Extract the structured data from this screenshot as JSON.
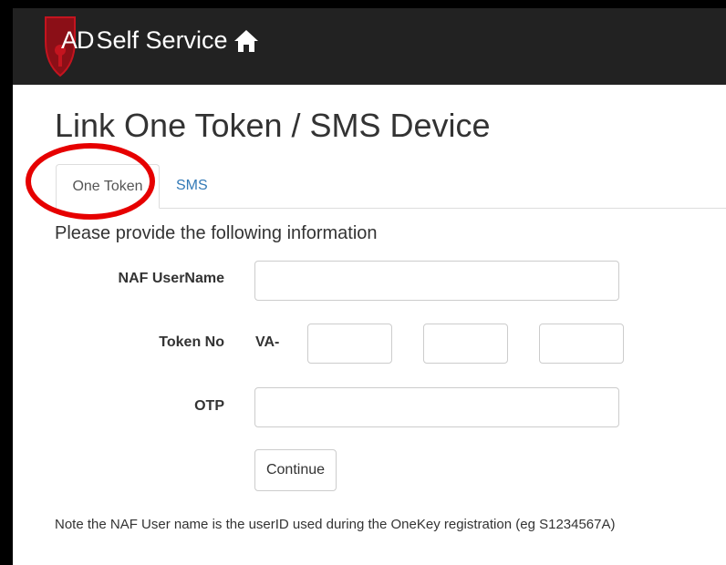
{
  "app": {
    "brand_ad": "AD",
    "brand_rest": "Self Service",
    "home_icon": "home-icon",
    "shield_icon": "shield-logo-icon"
  },
  "page": {
    "title": "Link One Token / SMS Device",
    "instructions": "Please provide the following information"
  },
  "tabs": [
    {
      "label": "One Token",
      "active": true
    },
    {
      "label": "SMS",
      "active": false
    }
  ],
  "form": {
    "username_label": "NAF UserName",
    "username_value": "",
    "token_label": "Token No",
    "token_prefix": "VA-",
    "token_values": [
      "",
      "",
      ""
    ],
    "otp_label": "OTP",
    "otp_value": "",
    "continue_label": "Continue"
  },
  "note": "Note the NAF User name is the userID used during the OneKey registration (eg S1234567A)",
  "colors": {
    "navbar": "#222222",
    "link": "#337ab7",
    "annotation": "#e60000",
    "logo": "#b3121d"
  }
}
